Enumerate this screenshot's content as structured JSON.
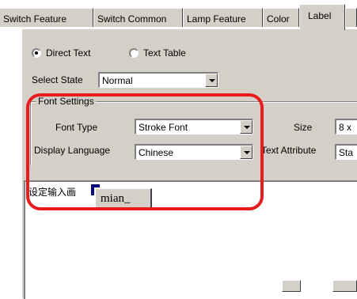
{
  "tabs": [
    {
      "label": "Switch Feature",
      "active": false
    },
    {
      "label": "Switch Common",
      "active": false
    },
    {
      "label": "Lamp Feature",
      "active": false
    },
    {
      "label": "Color",
      "active": false
    },
    {
      "label": "Label",
      "active": true
    }
  ],
  "text_source": {
    "options": [
      {
        "label": "Direct Text",
        "selected": true
      },
      {
        "label": "Text Table",
        "selected": false
      }
    ]
  },
  "select_state": {
    "label": "Select State",
    "value": "Normal"
  },
  "font_settings": {
    "group_label": "Font Settings",
    "font_type": {
      "label": "Font Type",
      "value": "Stroke Font"
    },
    "display_language": {
      "label": "Display Language",
      "value": "Chinese"
    },
    "size": {
      "label": "Size",
      "value": "8 x"
    },
    "text_attribute": {
      "label": "Text Attribute",
      "value": "Sta"
    }
  },
  "text_area": {
    "content": "设定输入画"
  },
  "ime": {
    "composition": "mian_"
  },
  "colors": {
    "highlight": "#e81c1c",
    "dialog_bg": "#d4d0c8",
    "ime_marker": "#000080"
  }
}
